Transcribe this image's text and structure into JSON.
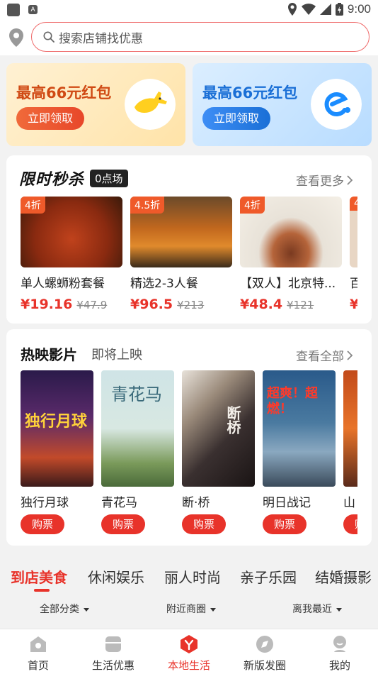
{
  "status_bar": {
    "time": "9:00",
    "badge_glyph": "A"
  },
  "search": {
    "placeholder": "搜索店铺找优惠"
  },
  "promos": [
    {
      "title": "最高66元红包",
      "button": "立即领取",
      "logo_icon": "kangaroo-icon",
      "color": "#d04a14"
    },
    {
      "title": "最高66元红包",
      "button": "立即领取",
      "logo_icon": "eleme-icon",
      "color": "#1a6fd6"
    }
  ],
  "flash_sale": {
    "title": "限时秒杀",
    "time_badge": "0点场",
    "more": "查看更多",
    "deals": [
      {
        "discount": "4折",
        "name": "单人螺蛳粉套餐",
        "price": "¥19.16",
        "original": "¥47.9"
      },
      {
        "discount": "4.5折",
        "name": "精选2-3人餐",
        "price": "¥96.5",
        "original": "¥213"
      },
      {
        "discount": "4折",
        "name": "【双人】北京特...",
        "price": "¥48.4",
        "original": "¥121"
      },
      {
        "discount": "4",
        "name": "百",
        "price": "¥",
        "original": ""
      }
    ]
  },
  "movies": {
    "title": "热映影片",
    "subtitle": "即将上映",
    "more": "查看全部",
    "buy_label": "购票",
    "items": [
      {
        "name": "独行月球",
        "poster_text": "独行月球"
      },
      {
        "name": "青花马",
        "poster_text": "青花马"
      },
      {
        "name": "断·桥",
        "poster_text": "断桥"
      },
      {
        "name": "明日战记",
        "poster_text": "超爽！超燃！"
      },
      {
        "name": "山",
        "poster_text": ""
      }
    ]
  },
  "categories": [
    "到店美食",
    "休闲娱乐",
    "丽人时尚",
    "亲子乐园",
    "结婚摄影"
  ],
  "filters": [
    "全部分类",
    "附近商圈",
    "离我最近"
  ],
  "nav": [
    {
      "label": "首页",
      "icon": "home-icon"
    },
    {
      "label": "生活优惠",
      "icon": "shop-icon"
    },
    {
      "label": "本地生活",
      "icon": "local-life-icon",
      "active": true
    },
    {
      "label": "新版发圈",
      "icon": "compass-icon"
    },
    {
      "label": "我的",
      "icon": "profile-icon"
    }
  ]
}
